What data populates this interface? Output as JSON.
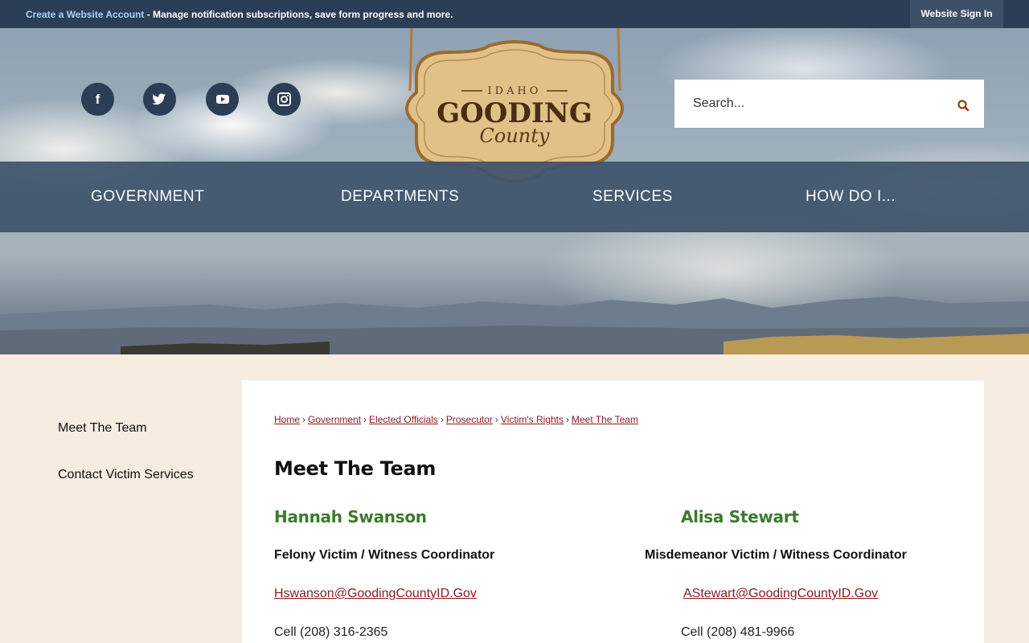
{
  "topbar": {
    "create_account_link": "Create a Website Account",
    "notice_text": " - Manage notification subscriptions, save form progress and more.",
    "signin_label": "Website Sign In"
  },
  "header": {
    "social": [
      {
        "name": "facebook",
        "glyph": "f"
      },
      {
        "name": "twitter",
        "glyph": "t"
      },
      {
        "name": "youtube",
        "glyph": "▶"
      },
      {
        "name": "instagram",
        "glyph": "◎"
      }
    ],
    "logo": {
      "top_text": "IDAHO",
      "main_text": "GOODING",
      "script_text": "County"
    },
    "search": {
      "placeholder": "Search..."
    }
  },
  "mainnav": {
    "items": [
      "GOVERNMENT",
      "DEPARTMENTS",
      "SERVICES",
      "HOW DO I..."
    ]
  },
  "sidebar": {
    "items": [
      "Meet The Team",
      "Contact Victim Services"
    ]
  },
  "breadcrumb": [
    "Home",
    "Government",
    "Elected Officials",
    "Prosecutor",
    "Victim's Rights",
    "Meet The Team"
  ],
  "page": {
    "title": "Meet The Team",
    "team": [
      {
        "name": "Hannah Swanson",
        "role": "Felony Victim / Witness Coordinator",
        "email": "Hswanson@GoodingCountyID.Gov",
        "phone": "Cell (208) 316-2365"
      },
      {
        "name": "Alisa Stewart",
        "role": "Misdemeanor Victim / Witness Coordinator",
        "email": "AStewart@GoodingCountyID.Gov",
        "phone": "Cell (208) 481-9966"
      }
    ]
  },
  "colors": {
    "topbar": "#2c3e55",
    "nav": "#3e526b",
    "page_bg": "#f6ece0",
    "link": "#8b1a1a",
    "name_green": "#3b7a2e"
  }
}
